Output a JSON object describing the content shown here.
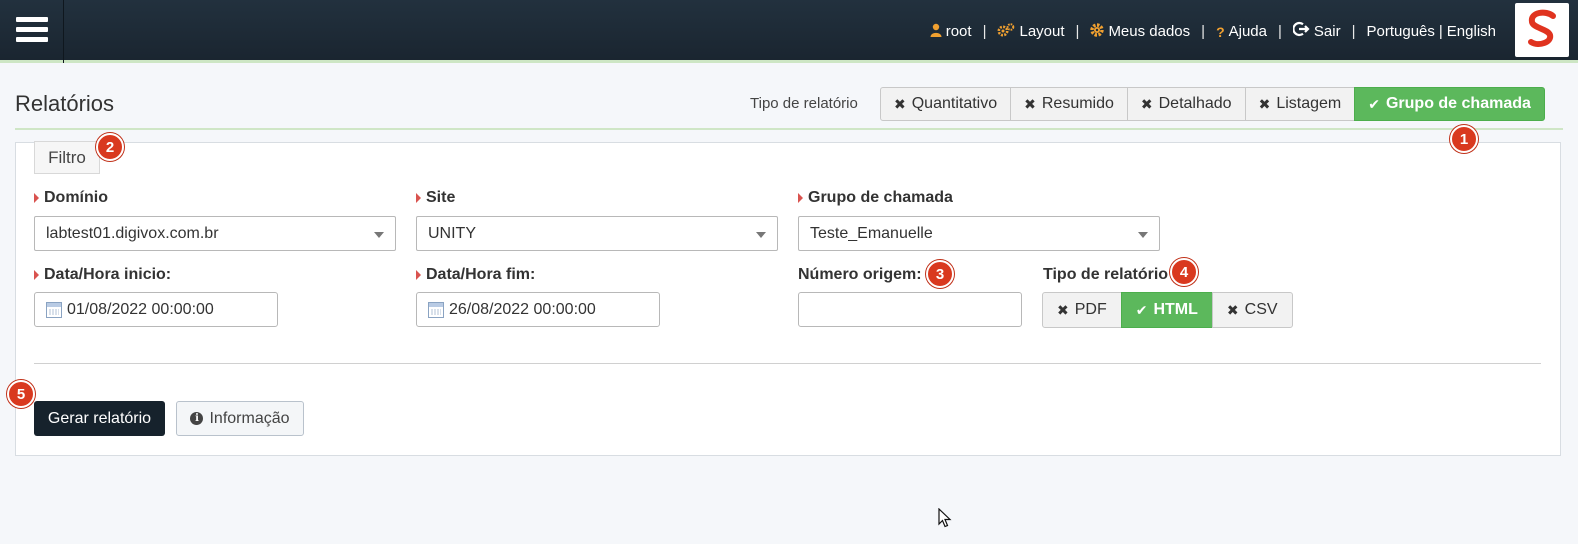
{
  "topbar": {
    "user": "root",
    "layout": "Layout",
    "my_data": "Meus dados",
    "help": "Ajuda",
    "logout": "Sair",
    "lang_pt": "Português",
    "lang_divider": "|",
    "lang_en": "English",
    "separator": "|"
  },
  "header": {
    "title": "Relatórios",
    "type_label": "Tipo de relatório",
    "report_types": [
      {
        "label": "Quantitativo",
        "selected": false
      },
      {
        "label": "Resumido",
        "selected": false
      },
      {
        "label": "Detalhado",
        "selected": false
      },
      {
        "label": "Listagem",
        "selected": false
      },
      {
        "label": "Grupo de chamada",
        "selected": true
      }
    ]
  },
  "filter": {
    "tab_label": "Filtro",
    "domain": {
      "label": "Domínio",
      "value": "labtest01.digivox.com.br"
    },
    "site": {
      "label": "Site",
      "value": "UNITY"
    },
    "call_group": {
      "label": "Grupo de chamada",
      "value": "Teste_Emanuelle"
    },
    "start": {
      "label": "Data/Hora inicio:",
      "value": "01/08/2022 00:00:00"
    },
    "end": {
      "label": "Data/Hora fim:",
      "value": "26/08/2022 00:00:00"
    },
    "origin_number": {
      "label": "Número origem:",
      "value": ""
    },
    "output_type": {
      "label": "Tipo de relatório",
      "options": [
        {
          "label": "PDF",
          "selected": false
        },
        {
          "label": "HTML",
          "selected": true
        },
        {
          "label": "CSV",
          "selected": false
        }
      ]
    }
  },
  "actions": {
    "generate": "Gerar relatório",
    "info": "Informação"
  },
  "badges": [
    "1",
    "2",
    "3",
    "4",
    "5"
  ],
  "colors": {
    "topbar": "#1e2b36",
    "active_green": "#5cb85c",
    "badge_red": "#d9391f",
    "primary_dark": "#16222c",
    "icon_orange": "#f0a030"
  }
}
